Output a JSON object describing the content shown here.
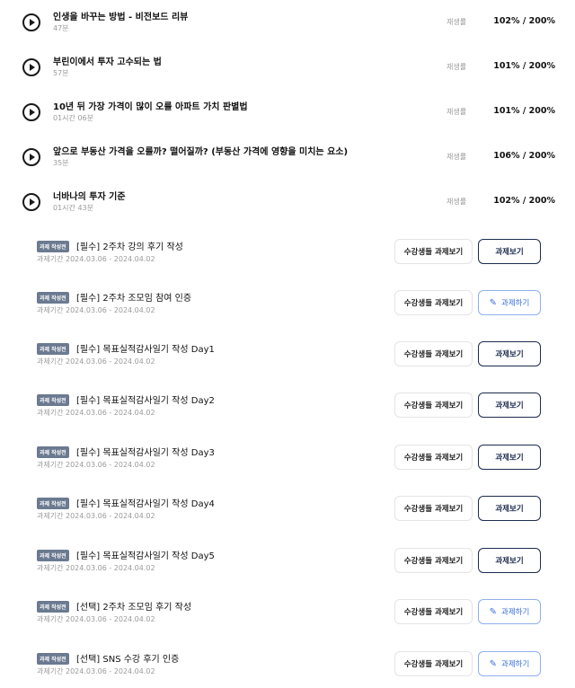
{
  "lectures": [
    {
      "title": "인생을 바꾸는 방법 - 비전보드 리뷰",
      "duration": "47분",
      "play_label": "재생률",
      "rate": "102% / 200%"
    },
    {
      "title": "부린이에서 투자 고수되는 법",
      "duration": "57분",
      "play_label": "재생률",
      "rate": "101% / 200%"
    },
    {
      "title": "10년 뒤 가장 가격이 많이 오를 아파트 가치 판별법",
      "duration": "01시간 06분",
      "play_label": "재생률",
      "rate": "101% / 200%"
    },
    {
      "title": "앞으로 부동산 가격을 오를까? 떨어질까? (부동산 가격에 영향을 미치는 요소)",
      "duration": "35분",
      "play_label": "재생률",
      "rate": "106% / 200%"
    },
    {
      "title": "너바나의 투자 기준",
      "duration": "01시간 43분",
      "play_label": "재생률",
      "rate": "102% / 200%"
    }
  ],
  "assignments": [
    {
      "badge": "과제 작성전",
      "title": "[필수] 2주차 강의 후기 작성",
      "period": "과제기간 2024.03.06 - 2024.04.02",
      "peer_label": "수강생들 과제보기",
      "action_label": "과제보기",
      "action_type": "view"
    },
    {
      "badge": "과제 작성전",
      "title": "[필수] 2주차 조모임 참여 인증",
      "period": "과제기간 2024.03.06 - 2024.04.02",
      "peer_label": "수강생들 과제보기",
      "action_label": "과제하기",
      "action_type": "do"
    },
    {
      "badge": "과제 작성전",
      "title": "[필수] 목표실적감사일기 작성 Day1",
      "period": "과제기간 2024.03.06 - 2024.04.02",
      "peer_label": "수강생들 과제보기",
      "action_label": "과제보기",
      "action_type": "view"
    },
    {
      "badge": "과제 작성전",
      "title": "[필수] 목표실적감사일기 작성 Day2",
      "period": "과제기간 2024.03.06 - 2024.04.02",
      "peer_label": "수강생들 과제보기",
      "action_label": "과제보기",
      "action_type": "view"
    },
    {
      "badge": "과제 작성전",
      "title": "[필수] 목표실적감사일기 작성 Day3",
      "period": "과제기간 2024.03.06 - 2024.04.02",
      "peer_label": "수강생들 과제보기",
      "action_label": "과제보기",
      "action_type": "view"
    },
    {
      "badge": "과제 작성전",
      "title": "[필수] 목표실적감사일기 작성 Day4",
      "period": "과제기간 2024.03.06 - 2024.04.02",
      "peer_label": "수강생들 과제보기",
      "action_label": "과제보기",
      "action_type": "view"
    },
    {
      "badge": "과제 작성전",
      "title": "[필수] 목표실적감사일기 작성 Day5",
      "period": "과제기간 2024.03.06 - 2024.04.02",
      "peer_label": "수강생들 과제보기",
      "action_label": "과제보기",
      "action_type": "view"
    },
    {
      "badge": "과제 작성전",
      "title": "[선택] 2주차 조모임 후기 작성",
      "period": "과제기간 2024.03.06 - 2024.04.02",
      "peer_label": "수강생들 과제보기",
      "action_label": "과제하기",
      "action_type": "do"
    },
    {
      "badge": "과제 작성전",
      "title": "[선택] SNS 수강 후기 인증",
      "period": "과제기간 2024.03.06 - 2024.04.02",
      "peer_label": "수강생들 과제보기",
      "action_label": "과제하기",
      "action_type": "do"
    }
  ],
  "icons": {
    "lecture": "play-circle-icon",
    "do_action": "pencil-icon"
  },
  "colors": {
    "badge": "#6b7a90",
    "view_border": "#1d2b4f",
    "do_border": "#8fb0ec",
    "do_text": "#3a6fdc",
    "muted": "#9a9a9a"
  }
}
